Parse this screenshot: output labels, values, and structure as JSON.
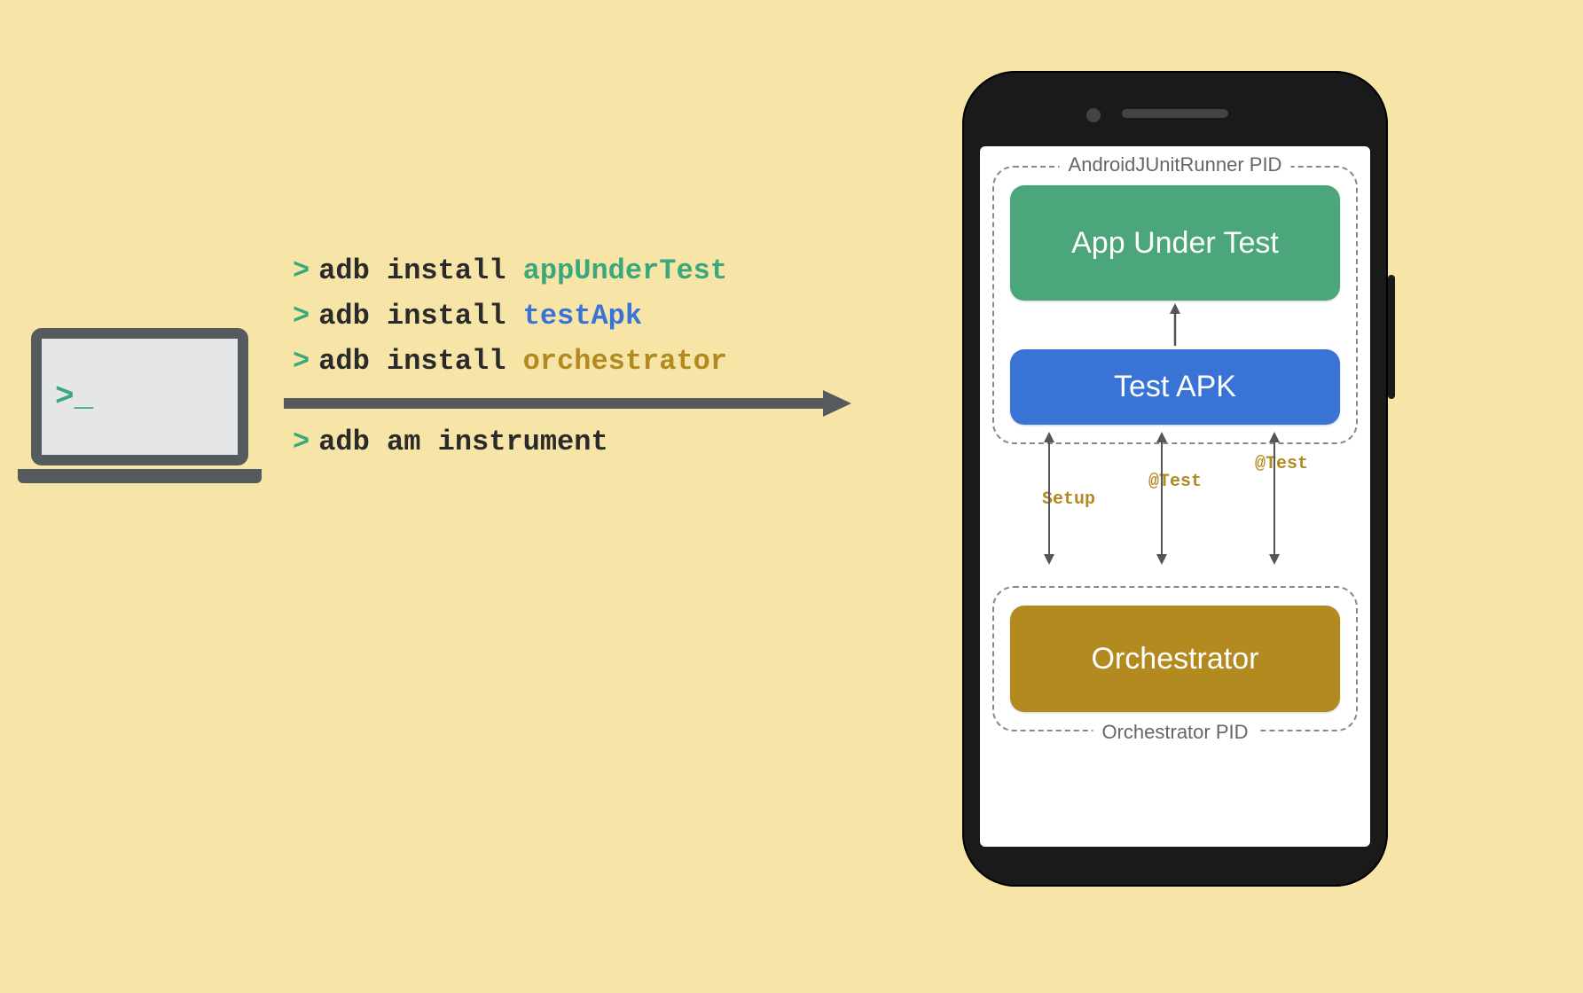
{
  "laptop": {
    "prompt": ">_"
  },
  "commands": [
    {
      "prompt": ">",
      "cmd": "adb install ",
      "arg": "appUnderTest",
      "argClass": "arg-green"
    },
    {
      "prompt": ">",
      "cmd": "adb install ",
      "arg": "testApk",
      "argClass": "arg-blue"
    },
    {
      "prompt": ">",
      "cmd": "adb install ",
      "arg": "orchestrator",
      "argClass": "arg-gold"
    }
  ],
  "commandAfterArrow": {
    "prompt": ">",
    "text": "adb am instrument"
  },
  "phone": {
    "runnerGroupLabel": "AndroidJUnitRunner PID",
    "orchestratorGroupLabel": "Orchestrator PID",
    "boxes": {
      "appUnderTest": "App Under Test",
      "testApk": "Test APK",
      "orchestrator": "Orchestrator"
    },
    "biArrowLabels": [
      "Setup",
      "@Test",
      "@Test"
    ]
  },
  "colors": {
    "green": "#4ba77b",
    "blue": "#3a73d6",
    "gold": "#b38a20",
    "bg": "#f7e5a8",
    "arrow": "#555a5f"
  }
}
